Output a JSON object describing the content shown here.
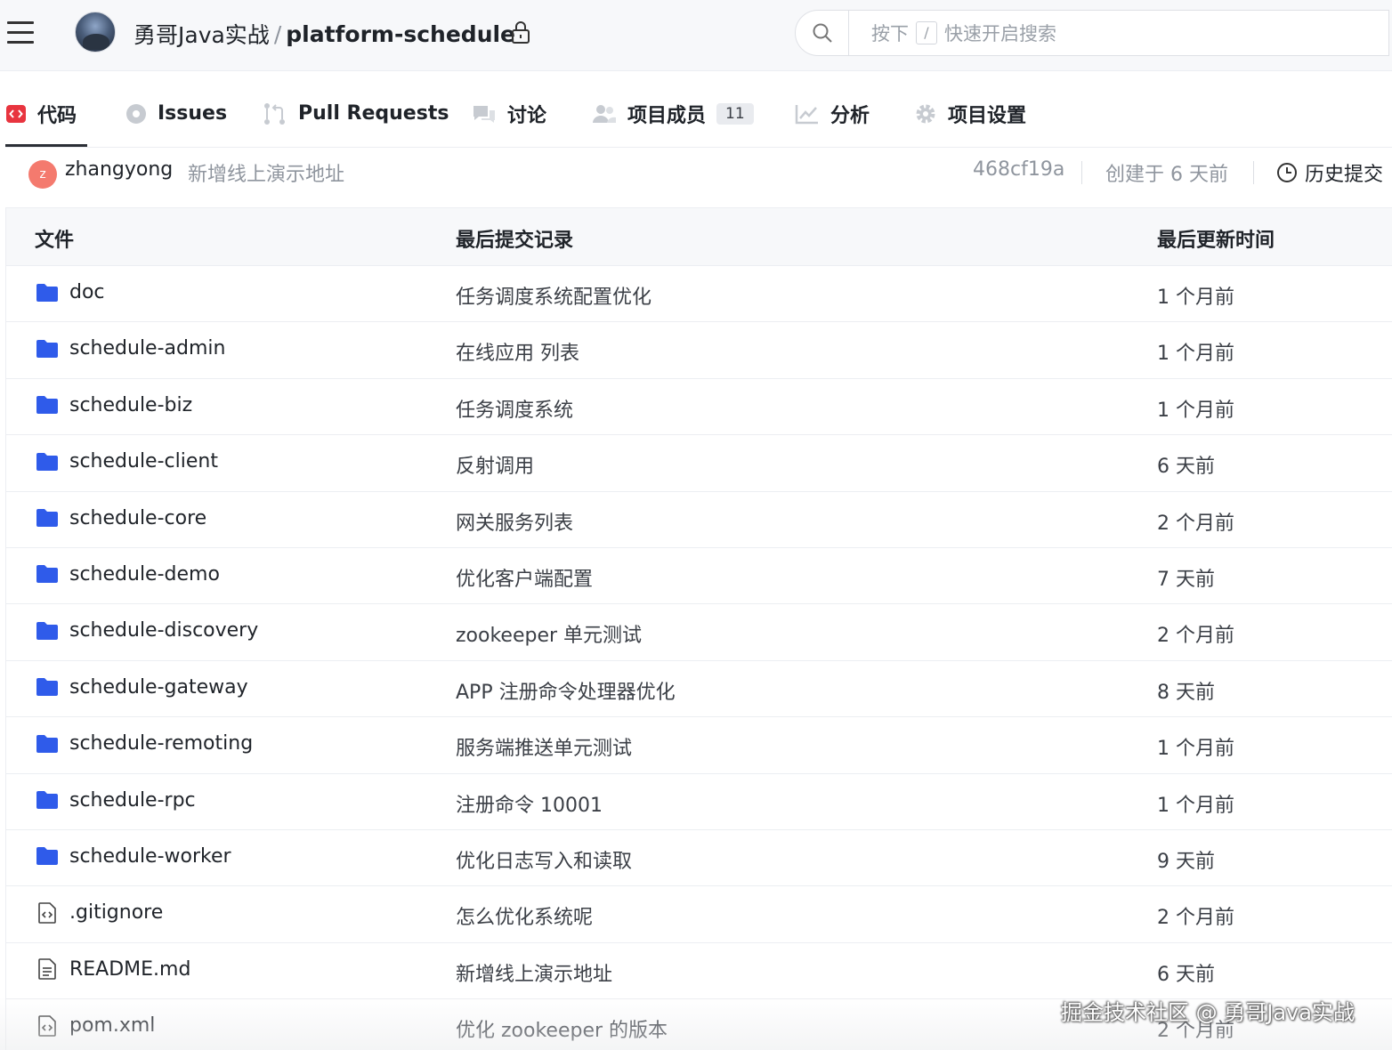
{
  "header": {
    "owner": "勇哥Java实战",
    "separator": "/",
    "repo": "platform-schedule",
    "search": {
      "prefix": "按下",
      "key": "/",
      "suffix": "快速开启搜索"
    }
  },
  "tabs": [
    {
      "label": "代码",
      "icon": "code-icon",
      "active": true
    },
    {
      "label": "Issues",
      "icon": "issue-icon"
    },
    {
      "label": "Pull Requests",
      "icon": "pull-request-icon"
    },
    {
      "label": "讨论",
      "icon": "discussion-icon"
    },
    {
      "label": "项目成员",
      "icon": "members-icon",
      "count": "11"
    },
    {
      "label": "分析",
      "icon": "chart-icon"
    },
    {
      "label": "项目设置",
      "icon": "gear-icon"
    }
  ],
  "commit": {
    "avatar_letter": "z",
    "author": "zhangyong",
    "message": "新增线上演示地址",
    "hash": "468cf19a",
    "created": "创建于 6 天前",
    "history": "历史提交"
  },
  "table": {
    "headers": {
      "file": "文件",
      "commit": "最后提交记录",
      "time": "最后更新时间"
    },
    "rows": [
      {
        "name": "doc",
        "type": "folder",
        "commit": "任务调度系统配置优化",
        "time": "1 个月前"
      },
      {
        "name": "schedule-admin",
        "type": "folder",
        "commit": "在线应用 列表",
        "time": "1 个月前"
      },
      {
        "name": "schedule-biz",
        "type": "folder",
        "commit": "任务调度系统",
        "time": "1 个月前"
      },
      {
        "name": "schedule-client",
        "type": "folder",
        "commit": "反射调用",
        "time": "6 天前"
      },
      {
        "name": "schedule-core",
        "type": "folder",
        "commit": "网关服务列表",
        "time": "2 个月前"
      },
      {
        "name": "schedule-demo",
        "type": "folder",
        "commit": "优化客户端配置",
        "time": "7 天前"
      },
      {
        "name": "schedule-discovery",
        "type": "folder",
        "commit": "zookeeper 单元测试",
        "time": "2 个月前"
      },
      {
        "name": "schedule-gateway",
        "type": "folder",
        "commit": "APP 注册命令处理器优化",
        "time": "8 天前"
      },
      {
        "name": "schedule-remoting",
        "type": "folder",
        "commit": "服务端推送单元测试",
        "time": "1 个月前"
      },
      {
        "name": "schedule-rpc",
        "type": "folder",
        "commit": "注册命令 10001",
        "time": "1 个月前"
      },
      {
        "name": "schedule-worker",
        "type": "folder",
        "commit": "优化日志写入和读取",
        "time": "9 天前"
      },
      {
        "name": ".gitignore",
        "type": "code-file",
        "commit": "怎么优化系统呢",
        "time": "2 个月前"
      },
      {
        "name": "README.md",
        "type": "text-file",
        "commit": "新增线上演示地址",
        "time": "6 天前"
      },
      {
        "name": "pom.xml",
        "type": "code-file",
        "commit": "优化 zookeeper 的版本",
        "time": "2 个月前"
      }
    ]
  },
  "watermark": "掘金技术社区 @ 勇哥Java实战",
  "colors": {
    "accent_red": "#e8343f",
    "folder_blue": "#2f5bea",
    "muted": "#8f959e"
  }
}
